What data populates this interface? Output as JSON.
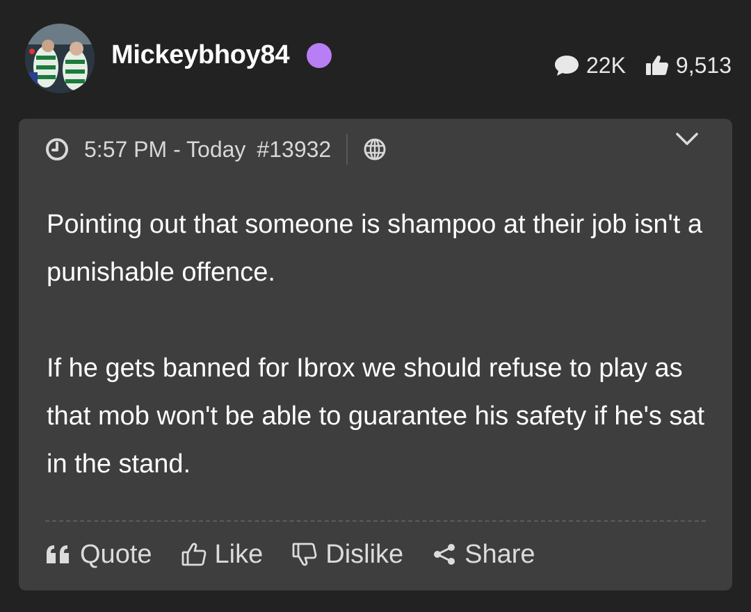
{
  "user": {
    "name": "Mickeybhoy84",
    "status_color": "#b77ef5",
    "comment_count": "22K",
    "like_count": "9,513"
  },
  "post": {
    "time": "5:57 PM - Today",
    "number": "#13932",
    "paragraphs": [
      "Pointing out that someone is shampoo at their job isn't a punishable offence.",
      "If he gets banned for Ibrox we should refuse to play as that mob won't be able to guarantee his safety if he's sat in the stand."
    ]
  },
  "actions": {
    "quote": "Quote",
    "like": "Like",
    "dislike": "Dislike",
    "share": "Share"
  },
  "icons": [
    "chat-bubble-icon",
    "thumbs-up-icon",
    "clock-icon",
    "globe-icon",
    "chevron-down-icon",
    "quote-icon",
    "like-icon",
    "dislike-icon",
    "share-icon"
  ]
}
